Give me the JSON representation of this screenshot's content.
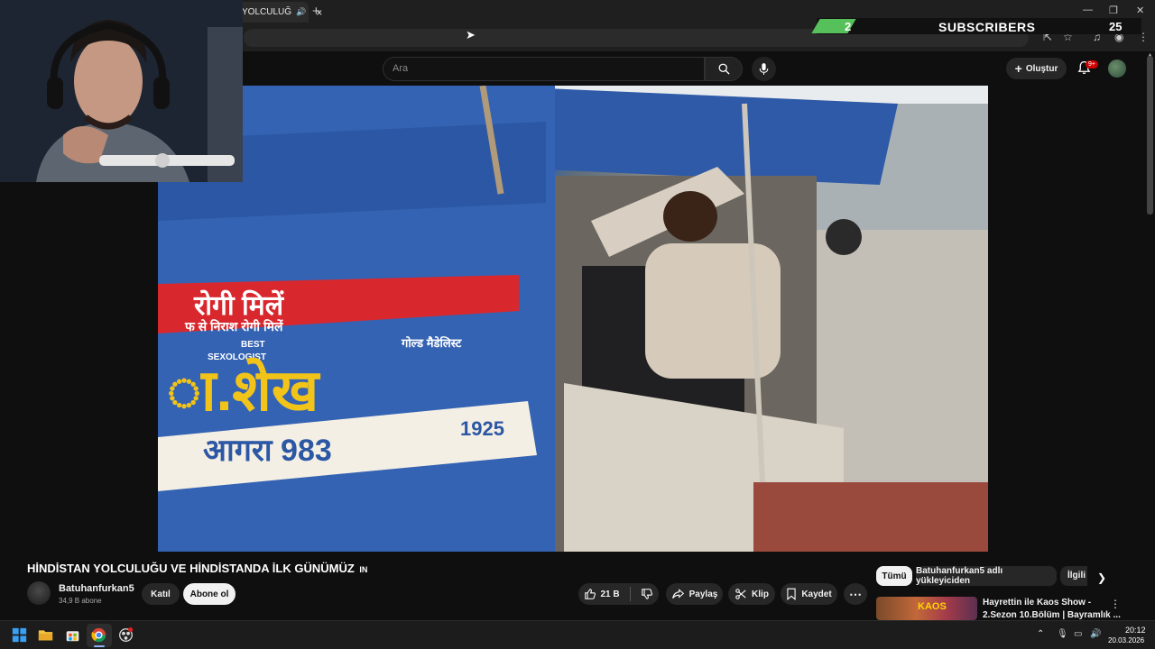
{
  "browser": {
    "tab_title": "YOLCULUĞ",
    "tab_close": "×",
    "new_tab": "+"
  },
  "overlay": {
    "subscriber_count": "2",
    "subscriber_label": "SUBSCRIBERS",
    "subscriber_goal": "25"
  },
  "header": {
    "search_placeholder": "Ara",
    "create_label": "Oluştur",
    "notification_badge": "9+"
  },
  "video": {
    "sign_line_1": "रोगी मिलें",
    "sign_line_2": "फ से निराश रोगी मिलें",
    "sign_best": "BEST",
    "sign_sexologist": "SEXOLOGIST",
    "sign_gold": "गोल्ड मैडेलिस्ट",
    "sign_name": "ा.शेख",
    "sign_city": "आगरा 983",
    "sign_phone_tail": "1925"
  },
  "watch": {
    "title": "HİNDİSTAN YOLCULUĞU VE HİNDİSTANDA İLK GÜNÜMÜZ",
    "title_suffix": "IN",
    "channel_name": "Batuhanfurkan5",
    "channel_subs": "34,9 B abone",
    "join_label": "Katıl",
    "subscribe_label": "Abone ol",
    "like_count": "21 B",
    "share_label": "Paylaş",
    "clip_label": "Klip",
    "save_label": "Kaydet"
  },
  "sidebar": {
    "chips": [
      "Tümü",
      "Batuhanfurkan5 adlı yükleyiciden",
      "İlgili"
    ],
    "rec_title_line1": "Hayrettin ile Kaos Show -",
    "rec_title_line2": "2.Sezon 10.Bölüm | Bayramlık ...",
    "rec_thumb_text": "KAOS"
  },
  "taskbar": {
    "time": "20:12",
    "date": "20.03.2026"
  },
  "colors": {
    "background": "#0f0f0f",
    "subscriber_accent": "#56c15a",
    "notification_red": "#cc0000",
    "sign_red": "#d8282e",
    "sign_yellow": "#f2c419"
  }
}
